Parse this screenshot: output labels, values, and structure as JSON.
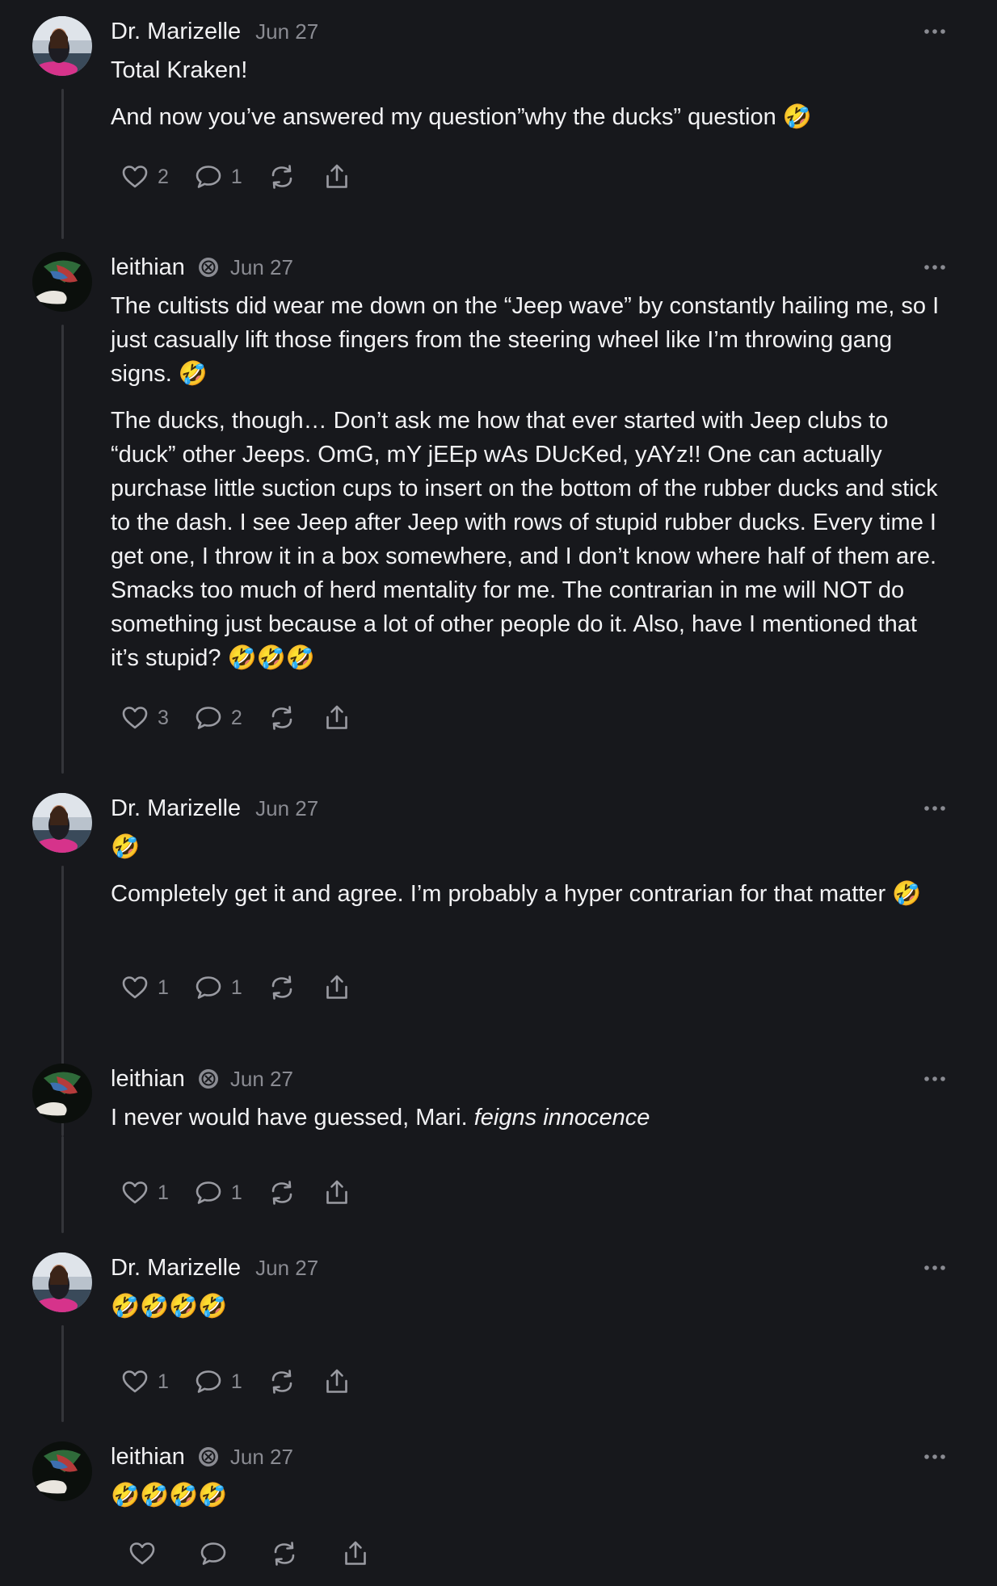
{
  "thread": {
    "posts": [
      {
        "author": "Dr. Marizelle",
        "date": "Jun 27",
        "paragraphs": [
          "Total Kraken!",
          "And now you’ve answered my question”why the ducks” question 🤣"
        ],
        "likes": "2",
        "replies": "1"
      },
      {
        "author": "leithian",
        "date": "Jun 27",
        "paragraphs": [
          "The cultists did wear me down on the “Jeep wave” by constantly hailing me, so I just casually lift those fingers from the steering wheel like I’m throwing gang signs. 🤣",
          "The ducks, though… Don’t ask me how that ever started with Jeep clubs to “duck” other Jeeps. OmG, mY jEEp wAs DUcKed, yAYz!! One can actually purchase little suction cups to insert on the bottom of the rubber ducks and stick to the dash. I see Jeep after Jeep with rows of stupid rubber ducks. Every time I get one, I throw it in a box somewhere, and I don’t know where half of them are. Smacks too much of herd mentality for me. The contrarian in me will NOT do something just because a lot of other people do it. Also, have I mentioned that it’s stupid? 🤣🤣🤣"
        ],
        "likes": "3",
        "replies": "2"
      },
      {
        "author": "Dr. Marizelle",
        "date": "Jun 27",
        "paragraphs": [
          "🤣",
          "Completely get it and agree. I’m probably a hyper contrarian for that matter 🤣"
        ],
        "likes": "1",
        "replies": "1"
      },
      {
        "author": "leithian",
        "date": "Jun 27",
        "text_plain": "I never would have guessed, Mari. ",
        "text_italic": "feigns innocence",
        "likes": "1",
        "replies": "1"
      },
      {
        "author": "Dr. Marizelle",
        "date": "Jun 27",
        "paragraphs": [
          "🤣🤣🤣🤣"
        ],
        "likes": "1",
        "replies": "1"
      },
      {
        "author": "leithian",
        "date": "Jun 27",
        "paragraphs": [
          "🤣🤣🤣🤣"
        ],
        "likes": "",
        "replies": ""
      }
    ]
  },
  "icons": {
    "like": "heart-icon",
    "reply": "comment-icon",
    "repost": "repost-icon",
    "share": "share-icon",
    "more": "more-dots-icon",
    "verified": "verified-badge-icon"
  },
  "colors": {
    "background": "#17181c",
    "text": "#f2f2f4",
    "muted": "#8a8b92",
    "thread_line": "#34353a"
  }
}
